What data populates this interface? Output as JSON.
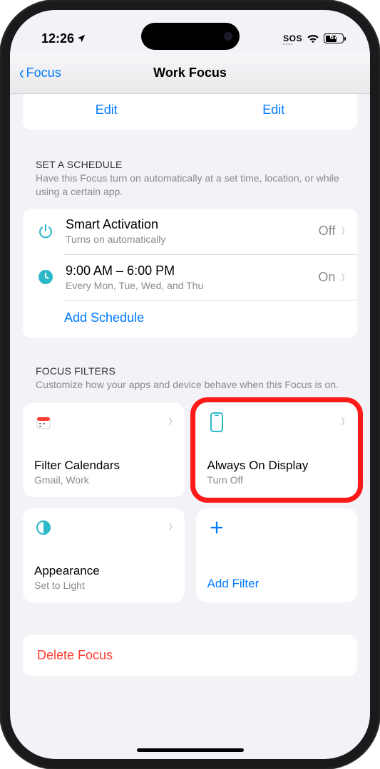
{
  "status": {
    "time": "12:26",
    "sos": "SOS",
    "battery_pct": "67"
  },
  "nav": {
    "back": "Focus",
    "title": "Work Focus"
  },
  "top_card": {
    "left": "Edit",
    "right": "Edit"
  },
  "schedule": {
    "header": "SET A SCHEDULE",
    "desc": "Have this Focus turn on automatically at a set time, location, or while using a certain app.",
    "rows": [
      {
        "title": "Smart Activation",
        "sub": "Turns on automatically",
        "trail": "Off"
      },
      {
        "title": "9:00 AM – 6:00 PM",
        "sub": "Every Mon, Tue, Wed, and Thu",
        "trail": "On"
      }
    ],
    "add": "Add Schedule"
  },
  "filters": {
    "header": "FOCUS FILTERS",
    "desc": "Customize how your apps and device behave when this Focus is on.",
    "tiles": [
      {
        "title": "Filter Calendars",
        "sub": "Gmail, Work"
      },
      {
        "title": "Always On Display",
        "sub": "Turn Off"
      },
      {
        "title": "Appearance",
        "sub": "Set to Light"
      },
      {
        "add": "Add Filter"
      }
    ]
  },
  "delete": {
    "label": "Delete Focus"
  }
}
